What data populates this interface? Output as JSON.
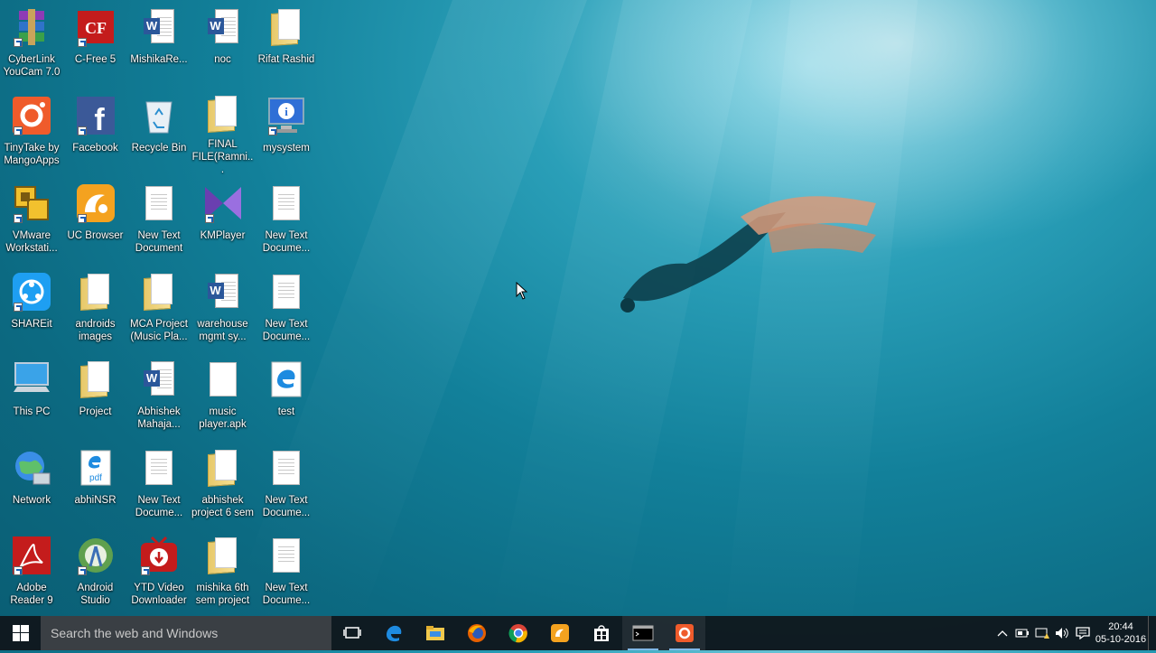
{
  "desktop": {
    "icons": [
      {
        "label": "CyberLink YouCam 7.0",
        "icon": "winrar-books-icon"
      },
      {
        "label": "C-Free 5",
        "icon": "cfree-icon"
      },
      {
        "label": "MishikaRe...",
        "icon": "word-doc-icon"
      },
      {
        "label": "noc",
        "icon": "word-doc-icon"
      },
      {
        "label": "Rifat Rashid",
        "icon": "folder-icon"
      },
      {
        "label": "TinyTake by MangoApps",
        "icon": "tinytake-icon"
      },
      {
        "label": "Facebook",
        "icon": "facebook-icon"
      },
      {
        "label": "Recycle Bin",
        "icon": "recycle-bin-icon"
      },
      {
        "label": "FINAL FILE(Ramni...",
        "icon": "folder-icon"
      },
      {
        "label": "mysystem",
        "icon": "system-info-icon"
      },
      {
        "label": "VMware Workstati...",
        "icon": "vmware-icon"
      },
      {
        "label": "UC Browser",
        "icon": "uc-browser-icon"
      },
      {
        "label": "New Text Document",
        "icon": "text-doc-icon"
      },
      {
        "label": "KMPlayer",
        "icon": "kmplayer-icon"
      },
      {
        "label": "New Text Docume...",
        "icon": "text-doc-icon"
      },
      {
        "label": "SHAREit",
        "icon": "shareit-icon"
      },
      {
        "label": "androids images",
        "icon": "folder-icon"
      },
      {
        "label": "MCA Project (Music Pla...",
        "icon": "folder-icon"
      },
      {
        "label": "warehouse mgmt sy...",
        "icon": "word-doc-icon"
      },
      {
        "label": "New Text Docume...",
        "icon": "text-doc-icon"
      },
      {
        "label": "This PC",
        "icon": "this-pc-icon"
      },
      {
        "label": "Project",
        "icon": "folder-icon"
      },
      {
        "label": "Abhishek Mahaja...",
        "icon": "word-doc-icon"
      },
      {
        "label": "music player.apk",
        "icon": "blank-file-icon"
      },
      {
        "label": "test",
        "icon": "edge-html-icon"
      },
      {
        "label": "Network",
        "icon": "network-icon"
      },
      {
        "label": "abhiNSR",
        "icon": "pdf-edge-icon"
      },
      {
        "label": "New Text Docume...",
        "icon": "text-doc-icon"
      },
      {
        "label": "abhishek project 6 sem",
        "icon": "folder-icon"
      },
      {
        "label": "New Text Docume...",
        "icon": "text-doc-icon"
      },
      {
        "label": "Adobe Reader 9",
        "icon": "adobe-reader-icon"
      },
      {
        "label": "Android Studio",
        "icon": "android-studio-icon"
      },
      {
        "label": "YTD Video Downloader",
        "icon": "ytd-icon"
      },
      {
        "label": "mishika 6th sem project",
        "icon": "folder-icon"
      },
      {
        "label": "New Text Docume...",
        "icon": "text-doc-icon"
      }
    ]
  },
  "taskbar": {
    "search_placeholder": "Search the web and Windows",
    "pinned": [
      "task-view-icon",
      "edge-icon",
      "file-explorer-icon",
      "firefox-icon",
      "chrome-icon",
      "uc-browser-icon",
      "store-icon",
      "cmd-icon",
      "tinytake-icon"
    ],
    "time": "20:44",
    "date": "05-10-2016"
  },
  "colors": {
    "taskbar": "#10161c",
    "accent": "#7fb8e8"
  }
}
